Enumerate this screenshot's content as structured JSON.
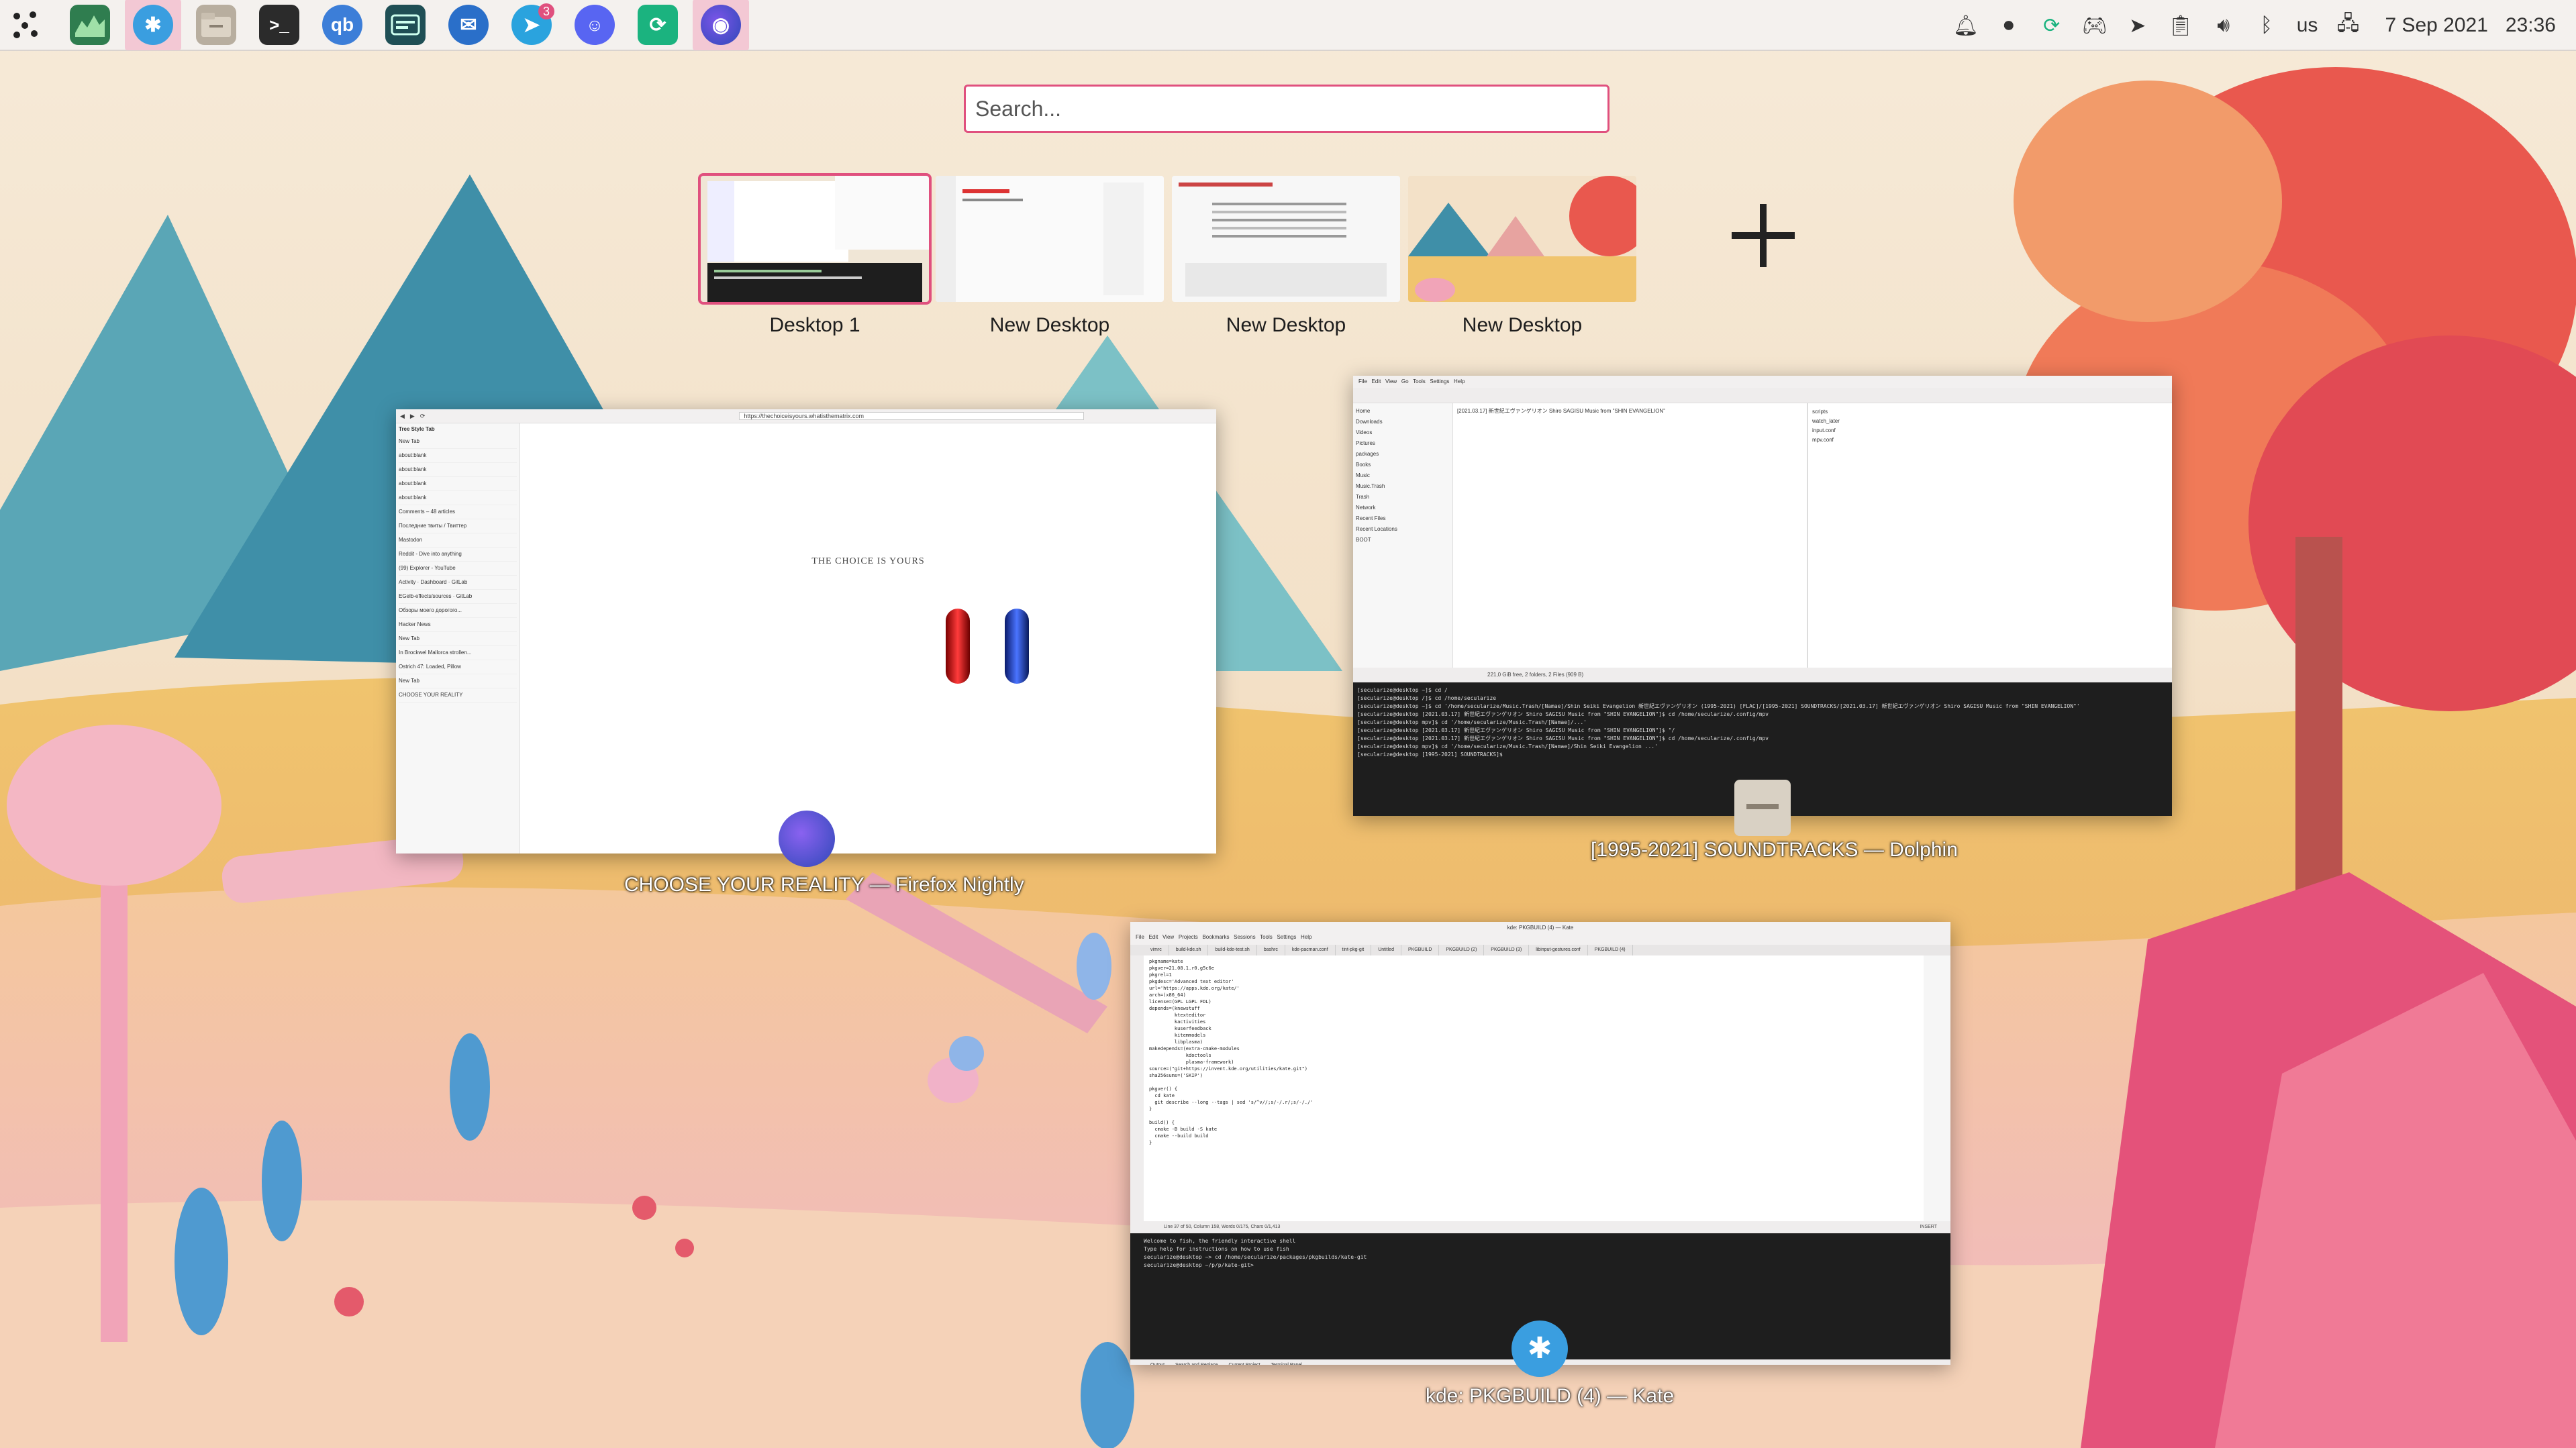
{
  "colors": {
    "accent": "#e0507e",
    "panel": "#f4f1ee",
    "terminal_bg": "#1e1e1e"
  },
  "panel": {
    "launcher_icon": "kde-overview-icon",
    "tasks": [
      {
        "name": "system-monitor",
        "icon": "graph-icon",
        "active": false
      },
      {
        "name": "kde-app",
        "icon": "kde-icon",
        "active": true
      },
      {
        "name": "file-manager",
        "icon": "folder-icon",
        "active": false
      },
      {
        "name": "terminal",
        "icon": "terminal-icon",
        "active": false
      },
      {
        "name": "qbittorrent",
        "icon": "qb-icon",
        "active": false
      },
      {
        "name": "media-player",
        "icon": "player-icon",
        "active": false
      },
      {
        "name": "thunderbird",
        "icon": "mail-icon",
        "active": false
      },
      {
        "name": "telegram",
        "icon": "telegram-icon",
        "active": false,
        "badge": "3"
      },
      {
        "name": "discord",
        "icon": "discord-icon",
        "active": false
      },
      {
        "name": "sync",
        "icon": "sync-icon",
        "active": false
      },
      {
        "name": "firefox",
        "icon": "firefox-icon",
        "active": true
      }
    ],
    "keyboard_layout": "us",
    "date": "7 Sep 2021",
    "time": "23:36"
  },
  "search": {
    "placeholder": "Search..."
  },
  "desktops": [
    {
      "label": "Desktop 1",
      "current": true
    },
    {
      "label": "New Desktop",
      "current": false
    },
    {
      "label": "New Desktop",
      "current": false
    },
    {
      "label": "New Desktop",
      "current": false
    }
  ],
  "windows": {
    "firefox": {
      "label": "CHOOSE YOUR REALITY — Firefox Nightly",
      "sidebar_title": "Tree Style Tab",
      "url": "https://thechoiceisyours.whatisthematrix.com",
      "page_text": "THE CHOICE IS YOURS",
      "tabs": [
        "New Tab",
        "about:blank",
        "about:blank",
        "about:blank",
        "about:blank",
        "Comments – 48 articles",
        "Последние твиты / Твиттер",
        "Mastodon",
        "Reddit - Dive into anything",
        "(99) Explorer - YouTube",
        "Activity · Dashboard · GitLab",
        "EGelb-effects/sources · GitLab",
        "Обзоры моего дорогого...",
        "Hacker News",
        "New Tab",
        "In Brockwel Mallorca strollen...",
        "Ostrich 47: Loaded, Pillow",
        "New Tab",
        "CHOOSE YOUR REALITY"
      ]
    },
    "dolphin": {
      "label": "[1995-2021] SOUNDTRACKS — Dolphin",
      "places": [
        "Home",
        "Downloads",
        "Videos",
        "Pictures",
        "packages",
        "Books",
        "Music",
        "Music.Trash",
        "Trash",
        "Network",
        "Recent Files",
        "Recent Locations",
        "BOOT"
      ],
      "left_entry": "[2021.03.17] 新世紀エヴァンゲリオン  Shiro SAGISU Music from \"SHIN EVANGELION\"",
      "right_entries": [
        "scripts",
        "watch_later",
        "input.conf",
        "mpv.conf"
      ],
      "status_left": "221,0 GiB free, 2 folders, 2 Files (909 B)",
      "terminal_lines": [
        "[secularize@desktop ~]$ cd /",
        "[secularize@desktop /]$ cd /home/secularize",
        "[secularize@desktop ~]$ cd '/home/secularize/Music.Trash/[Namae]/Shin Seiki Evangelion 新世紀エヴァンゲリオン (1995-2021) [FLAC]/[1995-2021] SOUNDTRACKS/[2021.03.17] 新世紀エヴァンゲリオン  Shiro SAGISU Music from \"SHIN EVANGELION\"'",
        "[secularize@desktop [2021.03.17] 新世紀エヴァンゲリオン  Shiro SAGISU Music from \"SHIN EVANGELION\"]$ cd /home/secularize/.config/mpv",
        "[secularize@desktop mpv]$ cd '/home/secularize/Music.Trash/[Namae]/...'",
        "[secularize@desktop [2021.03.17] 新世紀エヴァンゲリオン  Shiro SAGISU Music from \"SHIN EVANGELION\"]$ \"/",
        "[secularize@desktop [2021.03.17] 新世紀エヴァンゲリオン  Shiro SAGISU Music from \"SHIN EVANGELION\"]$ cd /home/secularize/.config/mpv",
        "[secularize@desktop mpv]$ cd '/home/secularize/Music.Trash/[Namae]/Shin Seiki Evangelion ...'",
        "[secularize@desktop [1995-2021] SOUNDTRACKS]$ "
      ]
    },
    "kate": {
      "label": "kde: PKGBUILD (4) — Kate",
      "title": "kde: PKGBUILD (4) — Kate",
      "tabs": [
        "vimrc",
        "build-kde.sh",
        "build-kde-test.sh",
        "bashrc",
        "kde-pacman.conf",
        "tint-pkg-git",
        "Untitled",
        "PKGBUILD",
        "PKGBUILD (2)",
        "PKGBUILD (3)",
        "libinput-gestures.conf",
        "PKGBUILD (4)"
      ],
      "code": [
        "pkgname=kate",
        "pkgver=21.08.1.r0.g5c6e",
        "pkgrel=1",
        "pkgdesc='Advanced text editor'",
        "url='https://apps.kde.org/kate/'",
        "arch=(x86_64)",
        "license=(GPL LGPL FDL)",
        "depends=(knewstuff",
        "         ktexteditor",
        "         kactivities",
        "         kuserfeedback",
        "         kitemmodels",
        "         libplasma)",
        "makedepends=(extra-cmake-modules",
        "             kdoctools",
        "             plasma-framework)",
        "source=(\"git+https://invent.kde.org/utilities/kate.git\")",
        "sha256sums=('SKIP')",
        "",
        "pkgver() {",
        "  cd kate",
        "  git describe --long --tags | sed 's/^v//;s/-/.r/;s/-/./'",
        "}",
        "",
        "build() {",
        "  cmake -B build -S kate",
        "  cmake --build build",
        "}"
      ],
      "status": "Line 37 of 50, Column 158, Words 0/175, Chars 0/1,413",
      "mode": "INSERT",
      "terminal_lines": [
        "Welcome to fish, the friendly interactive shell",
        "Type help for instructions on how to use fish",
        "secularize@desktop ~> cd /home/secularize/packages/pkgbuilds/kate-git",
        "secularize@desktop ~/p/p/kate-git> "
      ],
      "bottom_tabs": [
        "Output",
        "Search and Replace",
        "Current Project",
        "Terminal Panel"
      ]
    }
  }
}
